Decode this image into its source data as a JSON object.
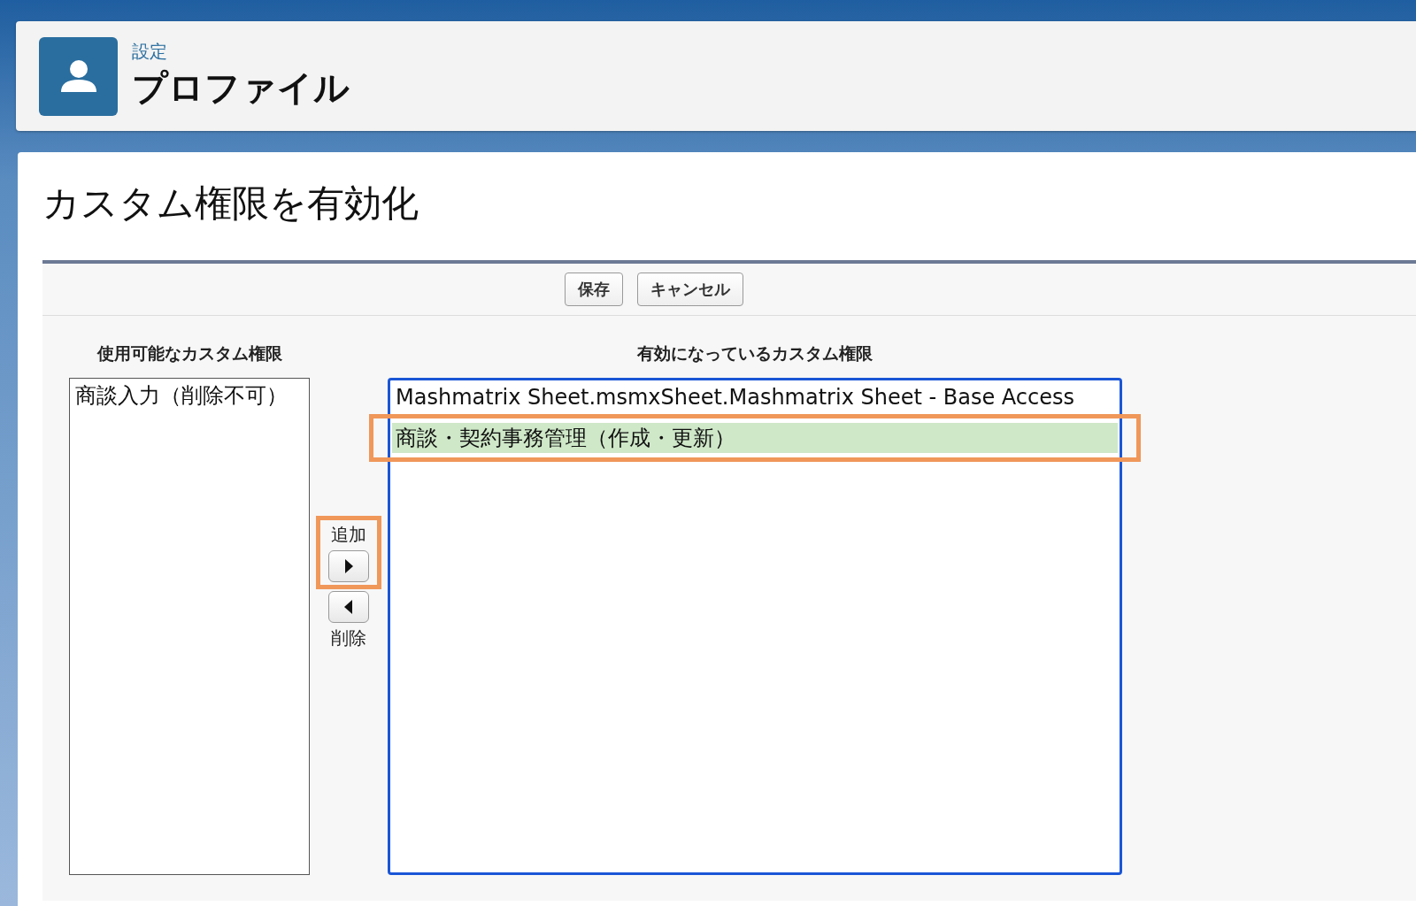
{
  "header": {
    "breadcrumb": "設定",
    "title": "プロファイル"
  },
  "page_title": "カスタム権限を有効化",
  "buttons": [
    {
      "label": "保存"
    },
    {
      "label": "キャンセル"
    }
  ],
  "available": {
    "heading": "使用可能なカスタム権限",
    "items": [
      {
        "label": "商談入力（削除不可）",
        "selected": false,
        "highlighted": false
      }
    ]
  },
  "controls": {
    "add_label": "追加",
    "add_highlighted": true,
    "remove_label": "削除"
  },
  "enabled": {
    "heading": "有効になっているカスタム権限",
    "items": [
      {
        "label": "Mashmatrix Sheet.msmxSheet.Mashmatrix Sheet - Base Access",
        "selected": false,
        "highlighted": false
      },
      {
        "label": "商談・契約事務管理（作成・更新）",
        "selected": true,
        "highlighted": true
      }
    ]
  }
}
